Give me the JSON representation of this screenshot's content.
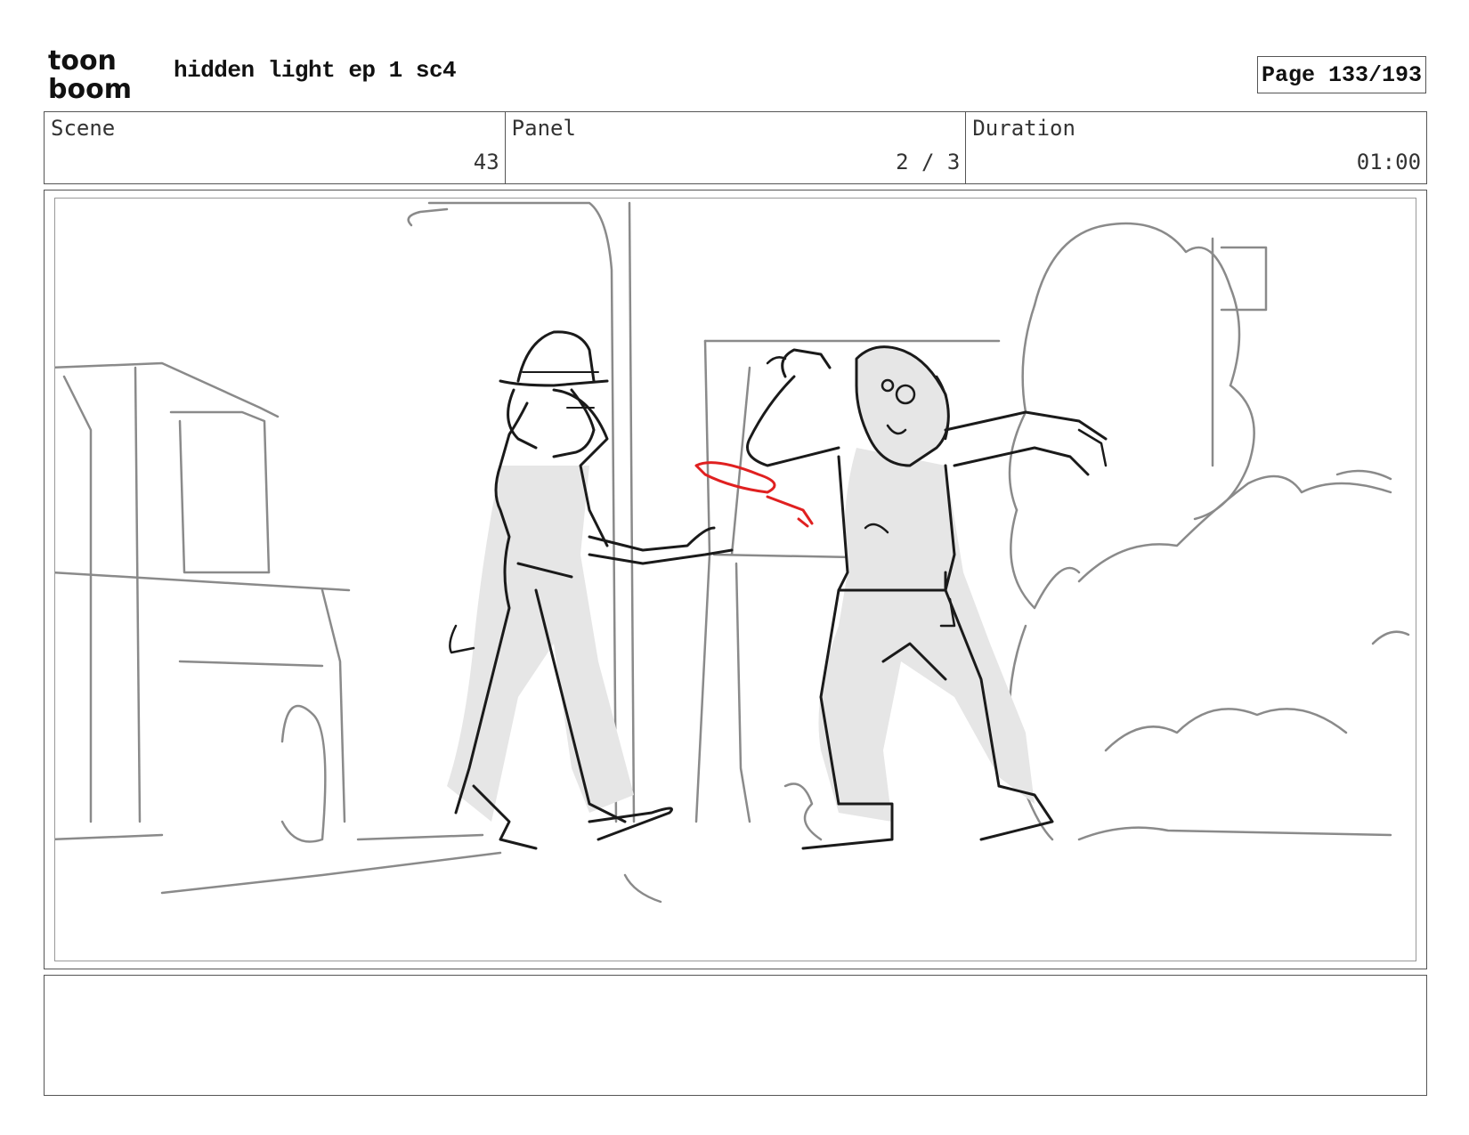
{
  "header": {
    "logo_line1": "toon",
    "logo_line2": "boom",
    "title": "hidden light ep 1 sc4",
    "page": "Page 133/193"
  },
  "info": {
    "scene_label": "Scene",
    "scene_value": "43",
    "panel_label": "Panel",
    "panel_value": "2 / 3",
    "duration_label": "Duration",
    "duration_value": "01:00"
  },
  "notes": {
    "text": ""
  },
  "colors": {
    "border": "#555555",
    "sketch_dark": "#1a1a1a",
    "sketch_grey": "#8a8a8a",
    "fill_grey": "#e6e6e6",
    "accent_red": "#e02020"
  }
}
